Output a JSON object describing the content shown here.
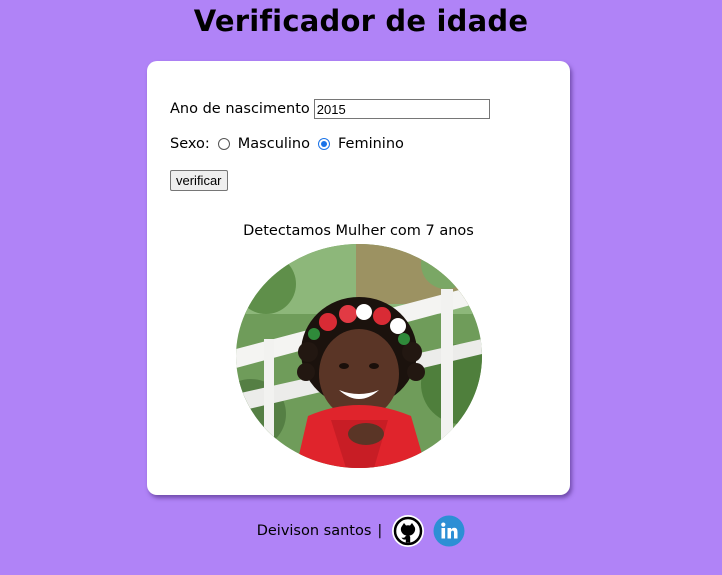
{
  "header": {
    "title": "Verificador de idade"
  },
  "form": {
    "year_label": "Ano de nascimento",
    "year_value": "2015",
    "sex_label": "Sexo:",
    "sex_options": [
      {
        "label": "Masculino",
        "checked": false
      },
      {
        "label": "Feminino",
        "checked": true
      }
    ],
    "verify_label": "verificar"
  },
  "result": {
    "text": "Detectamos Mulher com 7 anos"
  },
  "footer": {
    "author": "Deivison santos",
    "separator": "|",
    "links": [
      {
        "icon": "github-icon"
      },
      {
        "icon": "linkedin-icon"
      }
    ]
  },
  "colors": {
    "background": "#b083f7",
    "card": "#ffffff",
    "radio_accent": "#1a73e8",
    "linkedin": "#2d8fd5"
  }
}
